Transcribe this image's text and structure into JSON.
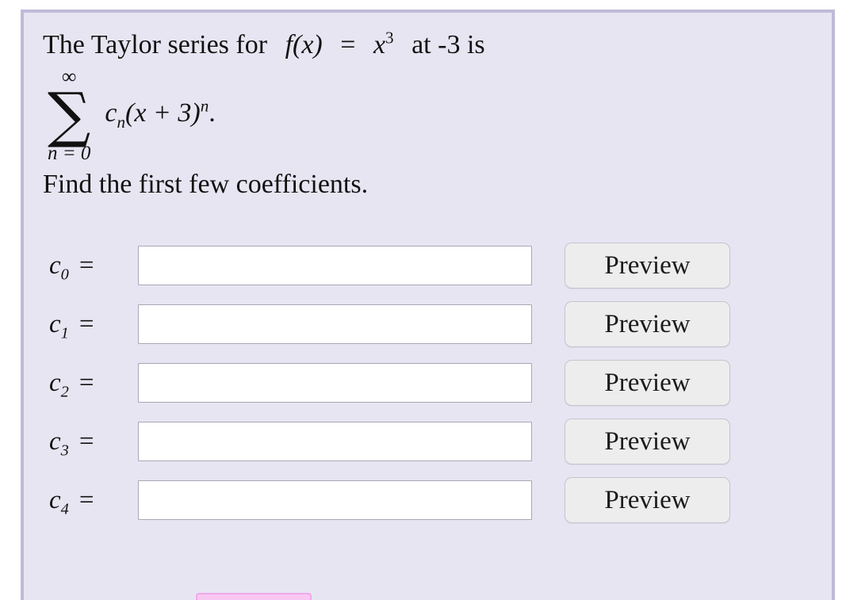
{
  "problem": {
    "intro_prefix": "The Taylor series for",
    "function_f": "f",
    "function_var": "(x)",
    "equals": "=",
    "function_body_base": "x",
    "function_body_exp": "3",
    "at_text": "at -3 is",
    "summation": {
      "upper_limit": "∞",
      "sigma": "∑",
      "lower_limit": "n = 0",
      "term_coeff": "c",
      "term_coeff_sub": "n",
      "term_binomial": "(x + 3)",
      "term_exponent": "n",
      "trailing_punctuation": "."
    },
    "instruction": "Find the first few coefficients."
  },
  "coefficients": [
    {
      "symbol": "c",
      "subscript": "0",
      "equals": "=",
      "value": "",
      "placeholder": "",
      "preview_label": "Preview"
    },
    {
      "symbol": "c",
      "subscript": "1",
      "equals": "=",
      "value": "",
      "placeholder": "",
      "preview_label": "Preview"
    },
    {
      "symbol": "c",
      "subscript": "2",
      "equals": "=",
      "value": "",
      "placeholder": "",
      "preview_label": "Preview"
    },
    {
      "symbol": "c",
      "subscript": "3",
      "equals": "=",
      "value": "",
      "placeholder": "",
      "preview_label": "Preview"
    },
    {
      "symbol": "c",
      "subscript": "4",
      "equals": "=",
      "value": "",
      "placeholder": "",
      "preview_label": "Preview"
    }
  ],
  "colors": {
    "panel_background": "#e8e5f2",
    "panel_border": "#bebbd8",
    "input_border": "#a9a7b8",
    "button_background": "#ededed",
    "button_border": "#c6c4ce",
    "submit_pink": "#f8c8f2",
    "text": "#111111"
  }
}
